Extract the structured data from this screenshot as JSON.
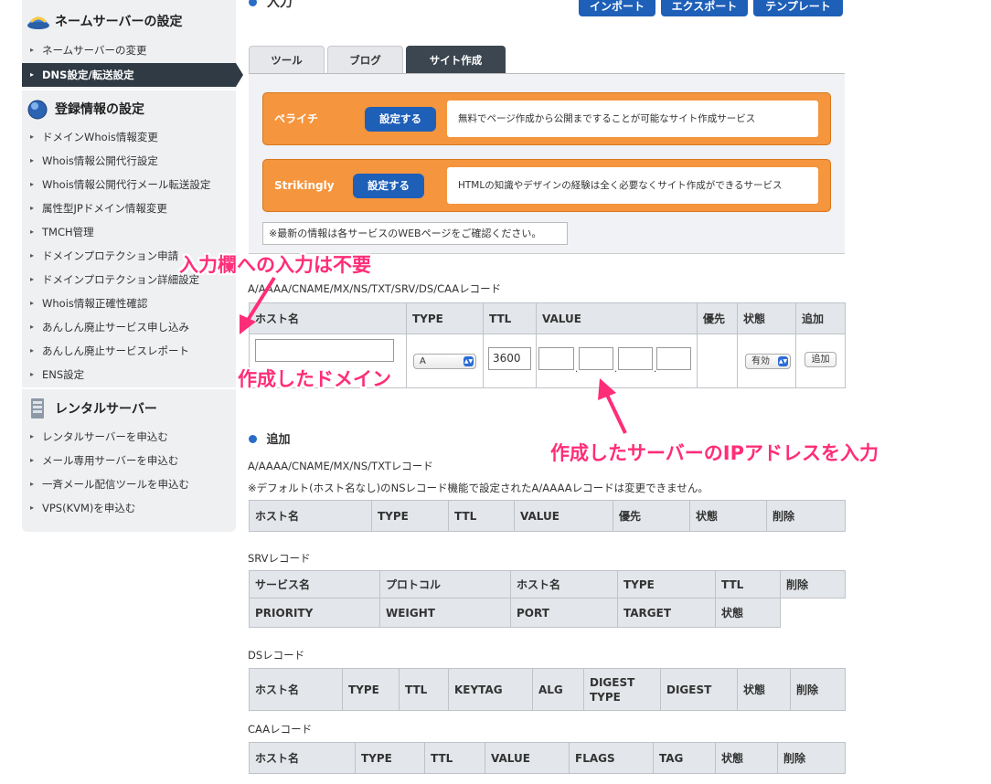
{
  "sidebar": {
    "sections": [
      {
        "title": "ネームサーバーの設定",
        "icon": "nameserver-globe-icon",
        "items": [
          "ネームサーバーの変更",
          "DNS設定/転送設定"
        ]
      },
      {
        "title": "登録情報の設定",
        "icon": "globe-icon",
        "items": [
          "ドメインWhois情報変更",
          "Whois情報公開代行設定",
          "Whois情報公開代行メール転送設定",
          "属性型JPドメイン情報変更",
          "TMCH管理",
          "ドメインプロテクション申請",
          "ドメインプロテクション詳細設定",
          "Whois情報正確性確認",
          "あんしん廃止サービス申し込み",
          "あんしん廃止サービスレポート",
          "ENS設定"
        ]
      },
      {
        "title": "レンタルサーバー",
        "icon": "server-icon",
        "items": [
          "レンタルサーバーを申込む",
          "メール専用サーバーを申込む",
          "一斉メール配信ツールを申込む",
          "VPS(KVM)を申込む"
        ]
      }
    ],
    "active_item": "DNS設定/転送設定"
  },
  "top": {
    "heading": "入力",
    "buttons": [
      "インポート",
      "エクスポート",
      "テンプレート"
    ]
  },
  "tabs": [
    "ツール",
    "ブログ",
    "サイト作成"
  ],
  "active_tab": "サイト作成",
  "promos": [
    {
      "name": "ペライチ",
      "button": "設定する",
      "desc": "無料でページ作成から公開まですることが可能なサイト作成サービス"
    },
    {
      "name": "Strikingly",
      "button": "設定する",
      "desc": "HTMLの知識やデザインの経験は全く必要なくサイト作成ができるサービス"
    }
  ],
  "notice": "※最新の情報は各サービスのWEBページをご確認ください。",
  "input_table": {
    "caption": "A/AAAA/CNAME/MX/NS/TXT/SRV/DS/CAAレコード",
    "headers": [
      "ホスト名",
      "TYPE",
      "TTL",
      "VALUE",
      "優先",
      "状態",
      "追加"
    ],
    "type_value": "A",
    "ttl_value": "3600",
    "status_value": "有効",
    "add_button": "追加"
  },
  "add_section": {
    "heading": "追加",
    "a_caption": "A/AAAA/CNAME/MX/NS/TXTレコード",
    "a_note": "※デフォルト(ホスト名なし)のNSレコード機能で設定されたA/AAAAレコードは変更できません。",
    "a_headers": [
      "ホスト名",
      "TYPE",
      "TTL",
      "VALUE",
      "優先",
      "状態",
      "削除"
    ],
    "srv_caption": "SRVレコード",
    "srv_headers_1": [
      "サービス名",
      "プロトコル",
      "ホスト名",
      "TYPE",
      "TTL",
      "削除"
    ],
    "srv_headers_2": [
      "PRIORITY",
      "WEIGHT",
      "PORT",
      "TARGET",
      "状態"
    ],
    "ds_caption": "DSレコード",
    "ds_headers": [
      "ホスト名",
      "TYPE",
      "TTL",
      "KEYTAG",
      "ALG",
      "DIGEST TYPE",
      "DIGEST",
      "状態",
      "削除"
    ],
    "caa_caption": "CAAレコード",
    "caa_headers": [
      "ホスト名",
      "TYPE",
      "TTL",
      "VALUE",
      "FLAGS",
      "TAG",
      "状態",
      "削除"
    ]
  },
  "annotations": {
    "no_input": "入力欄への入力は不要",
    "created_domain": "作成したドメイン",
    "server_ip": "作成したサーバーのIPアドレスを入力"
  },
  "colors": {
    "accent_blue": "#1e5fb8",
    "promo_orange": "#f5953d",
    "annotation_pink": "#ff2d78",
    "active_dark": "#2f3a44"
  }
}
